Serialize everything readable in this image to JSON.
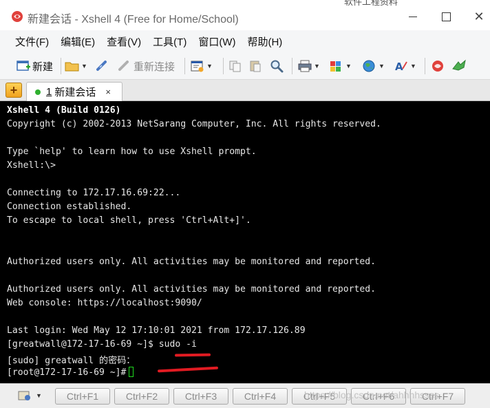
{
  "window": {
    "title": "新建会话 - Xshell 4 (Free for Home/School)",
    "overlay_text": "软件工程资料"
  },
  "menu": [
    "文件(F)",
    "编辑(E)",
    "查看(V)",
    "工具(T)",
    "窗口(W)",
    "帮助(H)"
  ],
  "toolbar": {
    "new_label": "新建",
    "reconnect_label": "重新连接"
  },
  "tab": {
    "number": "1",
    "label": "新建会话",
    "close": "×"
  },
  "terminal": {
    "lines": [
      "Xshell 4 (Build 0126)",
      "Copyright (c) 2002-2013 NetSarang Computer, Inc. All rights reserved.",
      "",
      "Type `help' to learn how to use Xshell prompt.",
      "Xshell:\\>",
      "",
      "Connecting to 172.17.16.69:22...",
      "Connection established.",
      "To escape to local shell, press 'Ctrl+Alt+]'.",
      "",
      "",
      "Authorized users only. All activities may be monitored and reported.",
      "",
      "Authorized users only. All activities may be monitored and reported.",
      "Web console: https://localhost:9090/",
      "",
      "Last login: Wed May 12 17:10:01 2021 from 172.17.126.89",
      "[greatwall@172-17-16-69 ~]$ sudo -i",
      "[sudo] greatwall 的密码：",
      "[root@172-17-16-69 ~]#"
    ]
  },
  "bottombar": {
    "keys": [
      "Ctrl+F1",
      "Ctrl+F2",
      "Ctrl+F3",
      "Ctrl+F4",
      "Ctrl+F5",
      "Ctrl+F6",
      "Ctrl+F7"
    ],
    "watermark": "https://blog.csdn.net/ahhhhssss"
  },
  "colors": {
    "terminal_bg": "#000000",
    "terminal_fg": "#e6e6e6",
    "cursor": "#1fdc1f",
    "annotation": "#e11b22"
  }
}
